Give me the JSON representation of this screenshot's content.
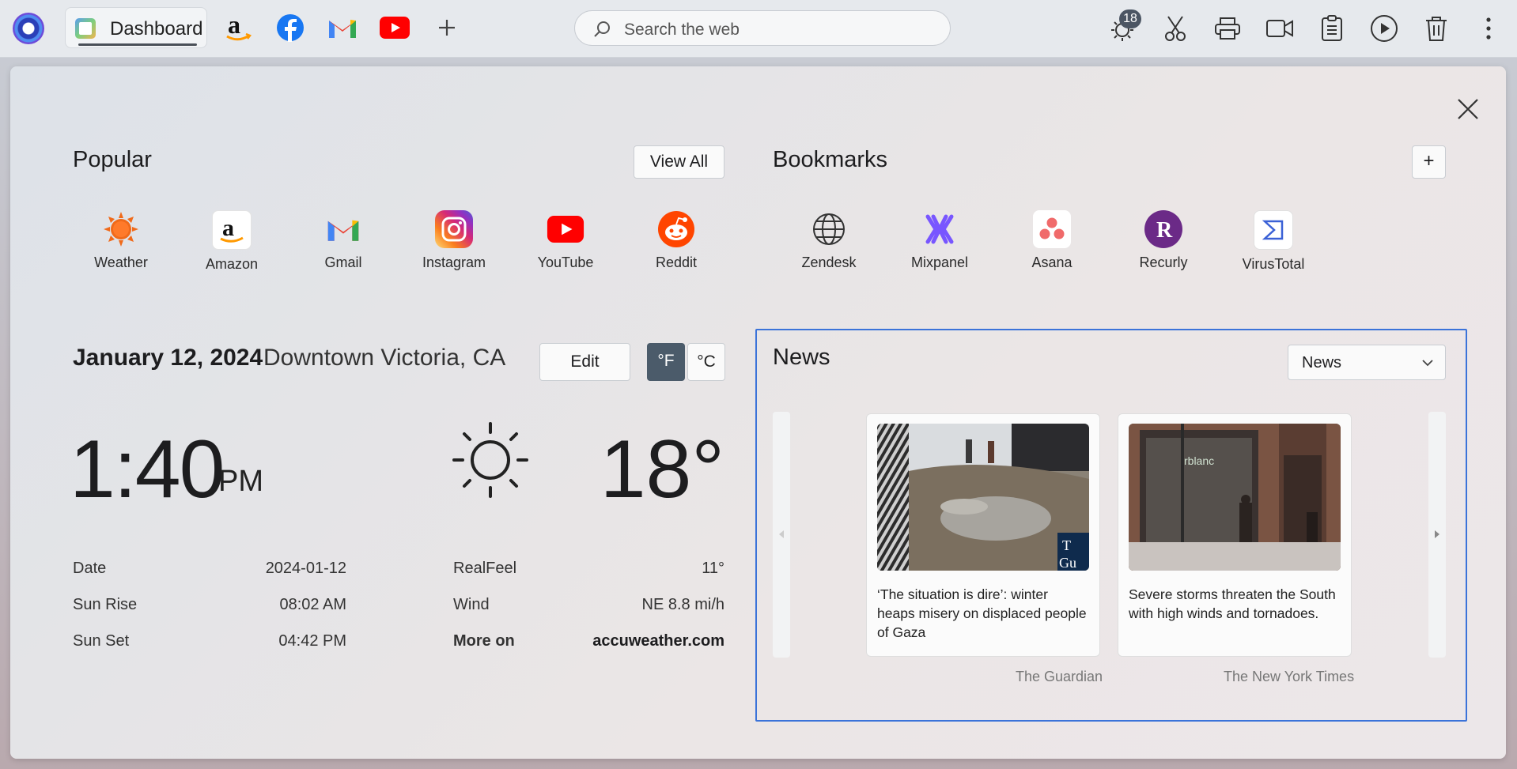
{
  "browser": {
    "active_tab": "Dashboard",
    "search_placeholder": "Search the web",
    "pinned_sites": [
      "amazon-icon",
      "facebook-icon",
      "gmail-icon",
      "youtube-icon"
    ],
    "notifications_count": "18",
    "toolbar_icons": [
      "weather-notification-icon",
      "scissors-icon",
      "printer-icon",
      "video-camera-icon",
      "clipboard-icon",
      "play-icon",
      "trash-icon",
      "more-icon"
    ]
  },
  "popular": {
    "title": "Popular",
    "view_all": "View All",
    "sites": [
      {
        "label": "Weather",
        "icon": "weather-sun-icon",
        "color": "#f06a1a"
      },
      {
        "label": "Amazon",
        "icon": "amazon-icon",
        "color": "#ff9900"
      },
      {
        "label": "Gmail",
        "icon": "gmail-icon",
        "color": "#ea4335"
      },
      {
        "label": "Instagram",
        "icon": "instagram-icon",
        "color": "#d6249f"
      },
      {
        "label": "YouTube",
        "icon": "youtube-icon",
        "color": "#ff0000"
      },
      {
        "label": "Reddit",
        "icon": "reddit-icon",
        "color": "#ff4500"
      }
    ]
  },
  "bookmarks": {
    "title": "Bookmarks",
    "add": "+",
    "sites": [
      {
        "label": "Zendesk",
        "icon": "globe-icon"
      },
      {
        "label": "Mixpanel",
        "icon": "mixpanel-icon",
        "color": "#7856ff"
      },
      {
        "label": "Asana",
        "icon": "asana-icon",
        "color": "#f06a6a"
      },
      {
        "label": "Recurly",
        "icon": "recurly-icon",
        "color": "#6b2a87"
      },
      {
        "label": "VirusTotal",
        "icon": "virustotal-icon",
        "color": "#3b61d6"
      }
    ]
  },
  "weather": {
    "date": "January 12, 2024",
    "location": "Downtown Victoria, CA",
    "edit": "Edit",
    "unit_f": "°F",
    "unit_c": "°C",
    "active_unit": "F",
    "time": "1:40",
    "ampm": "PM",
    "condition_icon": "sun-icon",
    "temperature": "18°",
    "left_rows": [
      {
        "label": "Date",
        "value": "2024-01-12"
      },
      {
        "label": "Sun Rise",
        "value": "08:02 AM"
      },
      {
        "label": "Sun Set",
        "value": "04:42 PM"
      }
    ],
    "right_rows": [
      {
        "label": "RealFeel",
        "value": "11°"
      },
      {
        "label": "Wind",
        "value": "NE 8.8 mi/h"
      },
      {
        "label": "More on",
        "value": "accuweather.com"
      }
    ]
  },
  "news": {
    "title": "News",
    "selected_feed": "News",
    "cards": [
      {
        "headline": "‘The situation is dire’: winter heaps misery on displaced people of Gaza",
        "source": "The Guardian"
      },
      {
        "headline": "Severe storms threaten the South with high winds and tornadoes.",
        "source": "The New York Times"
      }
    ],
    "accent": "#3b73d9"
  }
}
